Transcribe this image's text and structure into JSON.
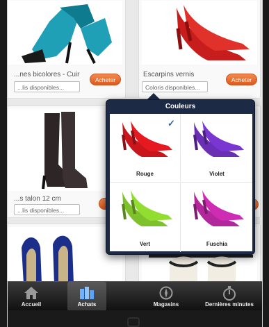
{
  "products": [
    {
      "name": "...nes bicolores - Cuir",
      "colors_placeholder": "...lis disponibles...",
      "buy_label": "Acheter"
    },
    {
      "name": "Escarpins vernis",
      "colors_placeholder": "Coloris disponibles...",
      "buy_label": "Acheter"
    },
    {
      "name": "...s talon 12 cm",
      "colors_placeholder": "...lis disponibles...",
      "buy_label": "Ac"
    },
    {
      "name": "",
      "colors_placeholder": "",
      "buy_label": "Ac"
    }
  ],
  "color_picker": {
    "title": "Couleurs",
    "options": [
      {
        "label": "Rouge",
        "color": "#c8161c",
        "selected": true
      },
      {
        "label": "Violet",
        "color": "#6a2fb5",
        "selected": false
      },
      {
        "label": "Vert",
        "color": "#7fc12a",
        "selected": false
      },
      {
        "label": "Fuschia",
        "color": "#b3279c",
        "selected": false
      }
    ]
  },
  "tabbar": {
    "items": [
      {
        "label": "Accueil",
        "icon": "home-icon",
        "active": false
      },
      {
        "label": "Achats",
        "icon": "shopping-icon",
        "active": true
      },
      {
        "label": "Magasins",
        "icon": "compass-icon",
        "active": false
      },
      {
        "label": "Dernières minutes",
        "icon": "stopwatch-icon",
        "active": false
      }
    ]
  },
  "theme": {
    "accent": "#e2642a",
    "popover_bg": "#1d2a45",
    "tabbar_bg": "#1e1e1e"
  }
}
